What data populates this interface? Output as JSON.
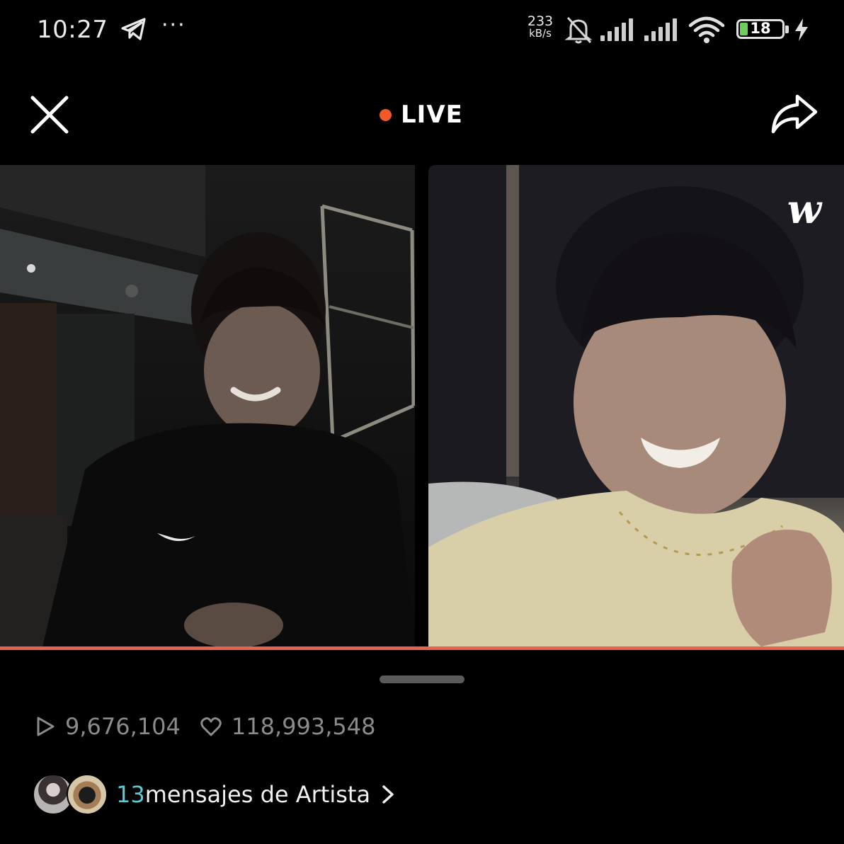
{
  "status_bar": {
    "time": "10:27",
    "more": "···",
    "net_speed_value": "233",
    "net_speed_unit": "kB/s",
    "battery_level": "18",
    "battery_fraction": 0.18,
    "icons": [
      "telegram-icon",
      "bell-off-icon",
      "signal-icon",
      "signal-icon",
      "wifi-icon",
      "battery-icon",
      "charging-icon"
    ]
  },
  "header": {
    "live_label": "LIVE",
    "live_color": "#f05a2a",
    "icons": [
      "close-icon",
      "share-icon"
    ]
  },
  "video": {
    "logo_text": "w",
    "progress_color": "#e8624f"
  },
  "stats": {
    "plays": "9,676,104",
    "likes": "118,993,548"
  },
  "artist_messages": {
    "count": "13",
    "label": "mensajes de Artista",
    "count_color": "#5ec8d4"
  }
}
